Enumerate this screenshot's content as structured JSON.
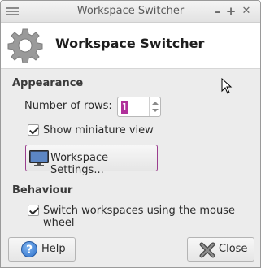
{
  "window": {
    "title": "Workspace Switcher",
    "controls": {
      "minimize": "–",
      "maximize": "+",
      "close": "✕"
    }
  },
  "header": {
    "icon": "gear-icon",
    "title": "Workspace Switcher"
  },
  "appearance": {
    "section_title": "Appearance",
    "rows_label": "Number of rows:",
    "rows_value": "1",
    "show_miniature_label": "Show miniature view",
    "show_miniature_checked": true,
    "settings_button_label": "Workspace Settings..."
  },
  "behaviour": {
    "section_title": "Behaviour",
    "mouse_wheel_label": "Switch workspaces using the mouse wheel",
    "mouse_wheel_checked": true
  },
  "footer": {
    "help_label": "Help",
    "close_label": "Close"
  },
  "colors": {
    "accent": "#9a3e8e",
    "selection": "#b0309a"
  }
}
